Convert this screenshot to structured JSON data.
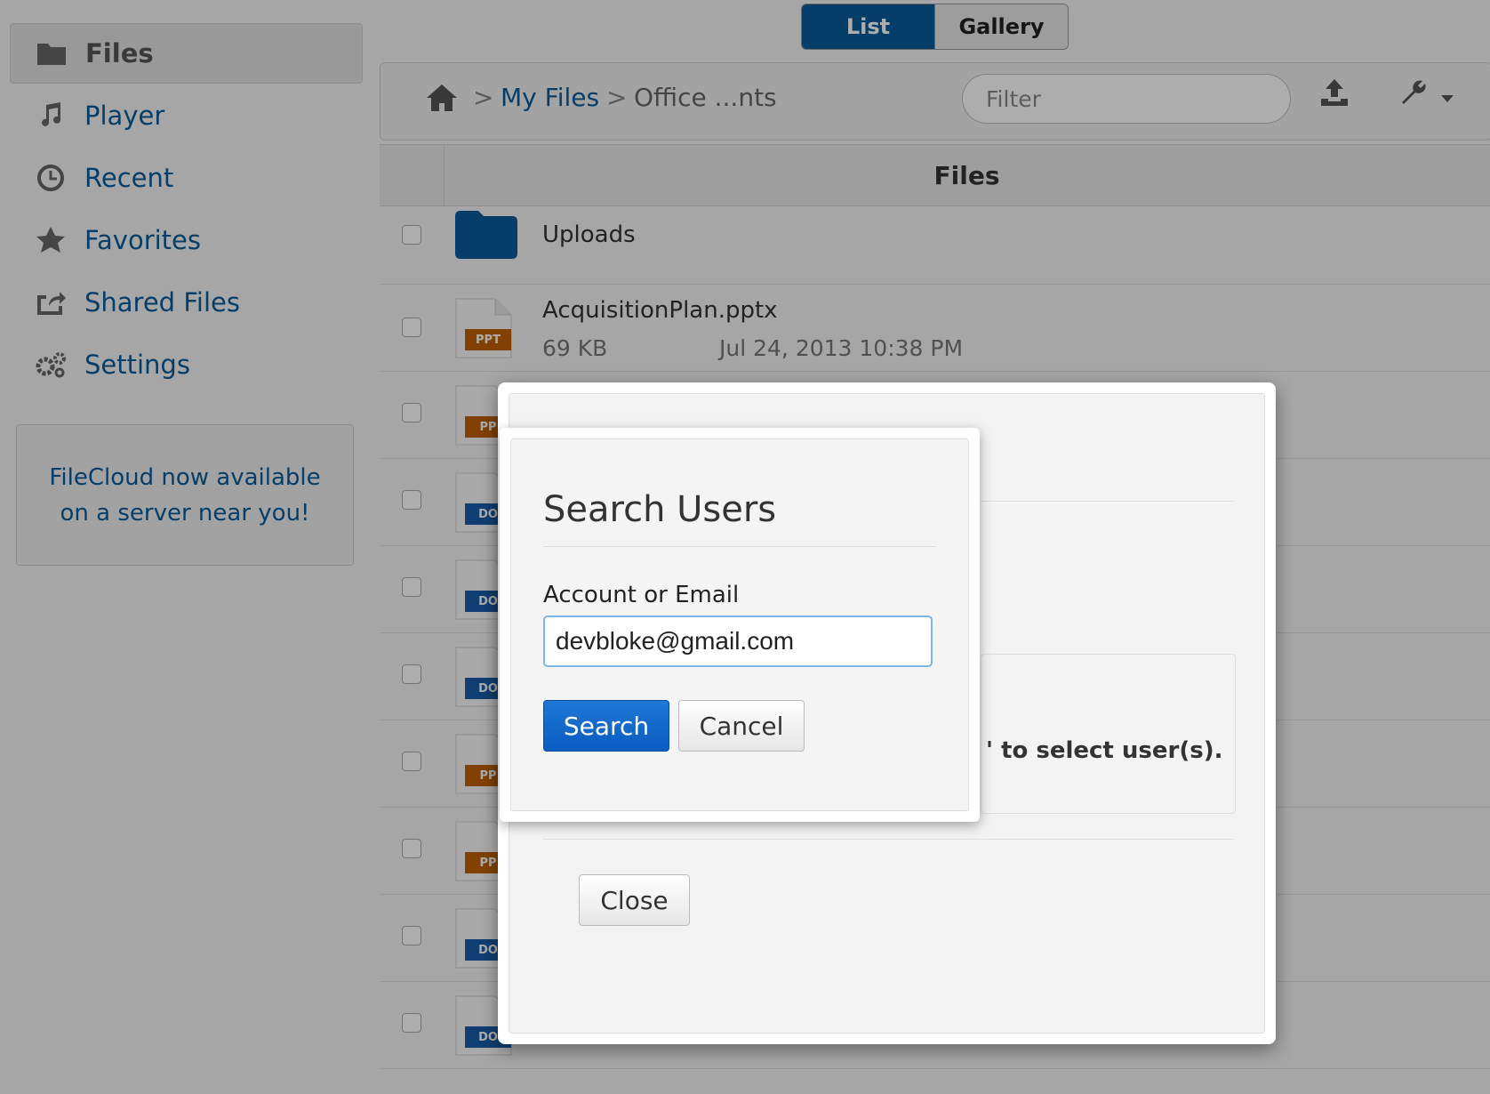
{
  "sidebar": {
    "items": [
      {
        "label": "Files",
        "icon": "folder-icon"
      },
      {
        "label": "Player",
        "icon": "music-note-icon"
      },
      {
        "label": "Recent",
        "icon": "clock-icon"
      },
      {
        "label": "Favorites",
        "icon": "star-icon"
      },
      {
        "label": "Shared Files",
        "icon": "share-icon"
      },
      {
        "label": "Settings",
        "icon": "gears-icon"
      }
    ],
    "promo": {
      "line1": "FileCloud now available",
      "line2": "on a server near you!"
    }
  },
  "view_toggle": {
    "list": "List",
    "gallery": "Gallery"
  },
  "toolbar": {
    "breadcrumb_sep": ">",
    "crumb1": "My Files",
    "crumb2": "Office ...nts",
    "filter_placeholder": "Filter"
  },
  "file_table": {
    "header": "Files",
    "rows": [
      {
        "name": "Uploads",
        "type": "folder"
      },
      {
        "name": "AcquisitionPlan.pptx",
        "size": "69 KB",
        "date": "Jul 24, 2013 10:38 PM",
        "badge": "PPT"
      },
      {
        "badge": "PP"
      },
      {
        "badge": "DO"
      },
      {
        "badge": "DO"
      },
      {
        "badge": "DO"
      },
      {
        "badge": "PP"
      },
      {
        "badge": "PP"
      },
      {
        "badge": "DO"
      },
      {
        "badge": "DO"
      }
    ]
  },
  "outer_dialog": {
    "hint_text": "' to select user(s).",
    "close_label": "Close"
  },
  "search_dialog": {
    "title": "Search Users",
    "field_label": "Account or Email",
    "field_value": "devbloke@gmail.com",
    "search_label": "Search",
    "cancel_label": "Cancel"
  },
  "colors": {
    "brand_blue": "#0a5c9c",
    "primary_button": "#0a5cc0"
  }
}
